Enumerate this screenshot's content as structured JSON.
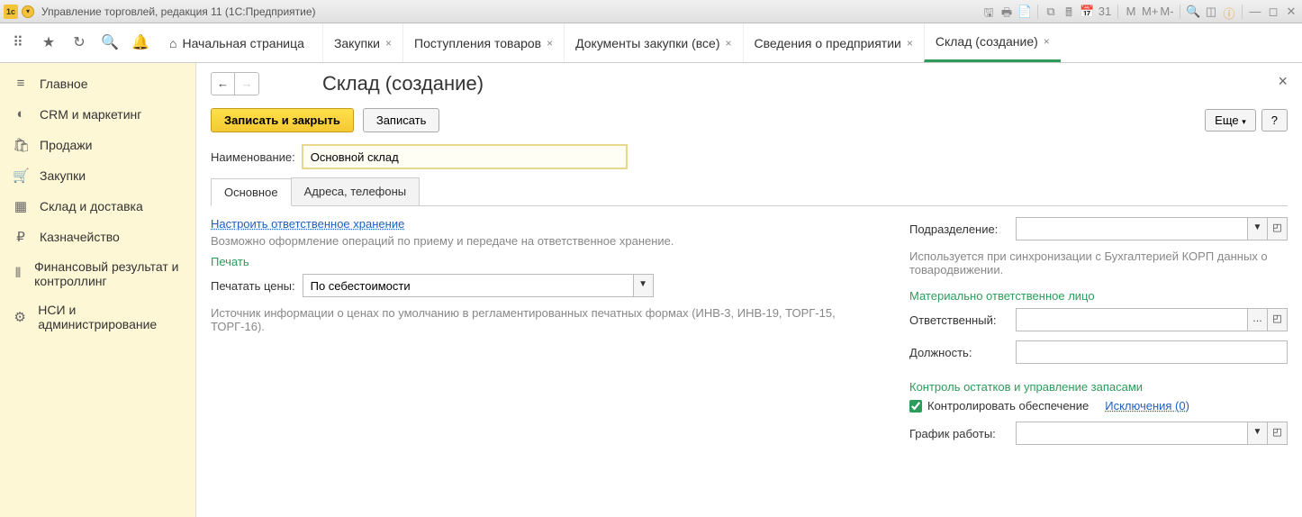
{
  "window": {
    "title": "Управление торговлей, редакция 11 (1С:Предприятие)"
  },
  "mainTabs": {
    "home": "Начальная страница",
    "items": [
      {
        "label": "Закупки"
      },
      {
        "label": "Поступления товаров"
      },
      {
        "label": "Документы закупки (все)"
      },
      {
        "label": "Сведения о предприятии"
      },
      {
        "label": "Склад (создание)",
        "active": true
      }
    ]
  },
  "sidebar": {
    "items": [
      {
        "icon": "≡",
        "label": "Главное"
      },
      {
        "icon": "◐",
        "label": "CRM и маркетинг"
      },
      {
        "icon": "🛍",
        "label": "Продажи"
      },
      {
        "icon": "🛒",
        "label": "Закупки"
      },
      {
        "icon": "▦",
        "label": "Склад и доставка"
      },
      {
        "icon": "₽",
        "label": "Казначейство"
      },
      {
        "icon": "⫴",
        "label": "Финансовый результат и контроллинг"
      },
      {
        "icon": "⚙",
        "label": "НСИ и администрирование"
      }
    ]
  },
  "page": {
    "title": "Склад (создание)",
    "saveClose": "Записать и закрыть",
    "save": "Записать",
    "more": "Еще",
    "help": "?",
    "nameLabel": "Наименование:",
    "nameValue": "Основной склад",
    "tabs": {
      "main": "Основное",
      "addresses": "Адреса, телефоны"
    },
    "left": {
      "storageLink": "Настроить ответственное хранение",
      "storageHint": "Возможно оформление операций по приему и передаче на ответственное хранение.",
      "printGroup": "Печать",
      "pricesLabel": "Печатать цены:",
      "pricesValue": "По себестоимости",
      "pricesHint": "Источник информации о ценах по умолчанию в регламентированных печатных формах (ИНВ-3, ИНВ-19, ТОРГ-15, ТОРГ-16)."
    },
    "right": {
      "divisionLabel": "Подразделение:",
      "divisionHint": "Используется при синхронизации с Бухгалтерией КОРП данных о товародвижении.",
      "responsibleGroup": "Материально ответственное лицо",
      "responsibleLabel": "Ответственный:",
      "positionLabel": "Должность:",
      "controlGroup": "Контроль остатков и управление запасами",
      "controlCheck": "Контролировать обеспечение",
      "exceptionsLink": "Исключения (0)",
      "scheduleLabel": "График работы:"
    }
  }
}
